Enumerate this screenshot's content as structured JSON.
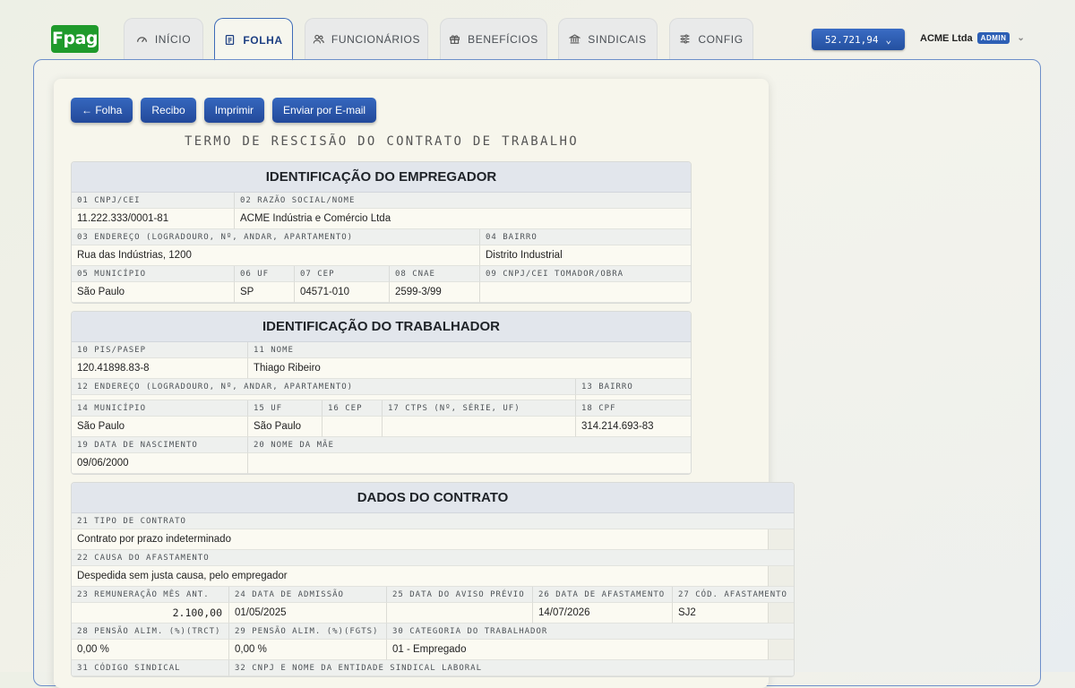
{
  "brand": {
    "logo": "Fpag"
  },
  "tabs": [
    {
      "label": "INÍCIO",
      "icon": "gauge-icon",
      "active": false
    },
    {
      "label": "FOLHA",
      "icon": "document-icon",
      "active": true
    },
    {
      "label": "FUNCIONÁRIOS",
      "icon": "users-icon",
      "active": false
    },
    {
      "label": "BENEFÍCIOS",
      "icon": "gift-icon",
      "active": false
    },
    {
      "label": "SINDICAIS",
      "icon": "bank-icon",
      "active": false
    },
    {
      "label": "CONFIG",
      "icon": "sliders-icon",
      "active": false
    }
  ],
  "header": {
    "balance": "52.721,94",
    "company": "ACME Ltda",
    "role": "ADMIN"
  },
  "toolbar": {
    "back": "← Folha",
    "receipt": "Recibo",
    "print": "Imprimir",
    "email": "Enviar por E-mail"
  },
  "document": {
    "title": "TERMO DE RESCISÃO DO CONTRATO DE TRABALHO"
  },
  "employer": {
    "heading": "IDENTIFICAÇÃO DO EMPREGADOR",
    "l01": "01 CNPJ/CEI",
    "v01": "11.222.333/0001-81",
    "l02": "02 RAZÃO SOCIAL/NOME",
    "v02": "ACME Indústria e Comércio Ltda",
    "l03": "03 ENDEREÇO (LOGRADOURO, Nº, ANDAR, APARTAMENTO)",
    "v03": "Rua das Indústrias, 1200",
    "l04": "04 BAIRRO",
    "v04": "Distrito Industrial",
    "l05": "05 MUNICÍPIO",
    "v05": "São Paulo",
    "l06": "06 UF",
    "v06": "SP",
    "l07": "07 CEP",
    "v07": "04571-010",
    "l08": "08 CNAE",
    "v08": "2599-3/99",
    "l09": "09 CNPJ/CEI TOMADOR/OBRA",
    "v09": ""
  },
  "worker": {
    "heading": "IDENTIFICAÇÃO DO TRABALHADOR",
    "l10": "10 PIS/PASEP",
    "v10": "120.41898.83-8",
    "l11": "11 NOME",
    "v11": "Thiago Ribeiro",
    "l12": "12 ENDEREÇO (LOGRADOURO, Nº, ANDAR, APARTAMENTO)",
    "v12": "",
    "l13": "13 BAIRRO",
    "v13": "",
    "l14": "14 MUNICÍPIO",
    "v14": "São Paulo",
    "l15": "15 UF",
    "v15": "São Paulo",
    "l16": "16 CEP",
    "v16": "",
    "l17": "17 CTPS (Nº, SÉRIE, UF)",
    "v17": "",
    "l18": "18 CPF",
    "v18": "314.214.693-83",
    "l19": "19 DATA DE NASCIMENTO",
    "v19": "09/06/2000",
    "l20": "20 NOME DA MÃE",
    "v20": ""
  },
  "contract": {
    "heading": "DADOS DO CONTRATO",
    "l21": "21 TIPO DE CONTRATO",
    "v21": "Contrato por prazo indeterminado",
    "l22": "22 CAUSA DO AFASTAMENTO",
    "v22": "Despedida sem justa causa, pelo empregador",
    "l23": "23 REMUNERAÇÃO MÊS ANT.",
    "v23": "2.100,00",
    "l24": "24 DATA DE ADMISSÃO",
    "v24": "01/05/2025",
    "l25": "25 DATA DO AVISO PRÉVIO",
    "v25": "",
    "l26": "26 DATA DE AFASTAMENTO",
    "v26": "14/07/2026",
    "l27": "27 CÓD. AFASTAMENTO",
    "v27": "SJ2",
    "l28": "28 PENSÃO ALIM. (%)(TRCT)",
    "v28": "0,00 %",
    "l29": "29 PENSÃO ALIM. (%)(FGTS)",
    "v29": "0,00 %",
    "l30": "30 CATEGORIA DO TRABALHADOR",
    "v30": "01 - Empregado",
    "l31": "31 CÓDIGO SINDICAL",
    "l32": "32 CNPJ E NOME DA ENTIDADE SINDICAL LABORAL"
  }
}
